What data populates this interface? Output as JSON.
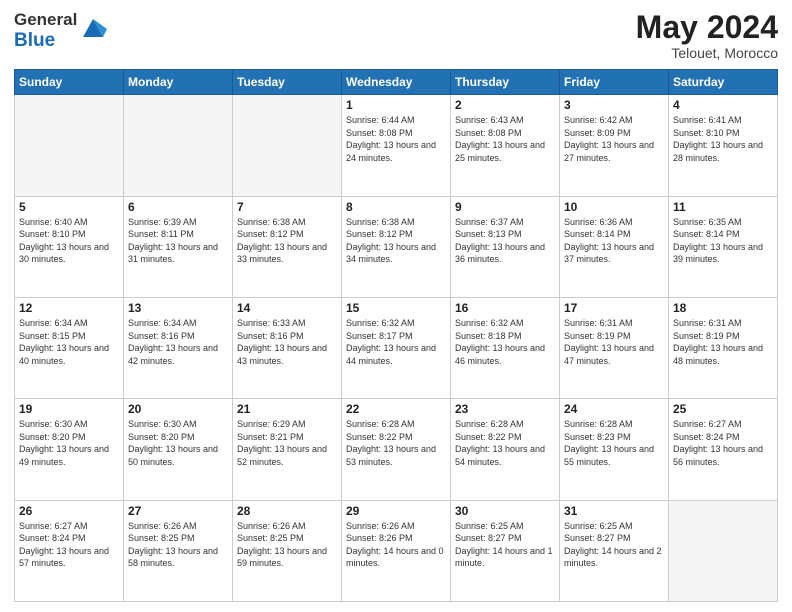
{
  "header": {
    "logo_general": "General",
    "logo_blue": "Blue",
    "title": "May 2024",
    "location": "Telouet, Morocco"
  },
  "weekdays": [
    "Sunday",
    "Monday",
    "Tuesday",
    "Wednesday",
    "Thursday",
    "Friday",
    "Saturday"
  ],
  "weeks": [
    [
      {
        "day": "",
        "sunrise": "",
        "sunset": "",
        "daylight": "",
        "empty": true
      },
      {
        "day": "",
        "sunrise": "",
        "sunset": "",
        "daylight": "",
        "empty": true
      },
      {
        "day": "",
        "sunrise": "",
        "sunset": "",
        "daylight": "",
        "empty": true
      },
      {
        "day": "1",
        "sunrise": "Sunrise: 6:44 AM",
        "sunset": "Sunset: 8:08 PM",
        "daylight": "Daylight: 13 hours and 24 minutes.",
        "empty": false
      },
      {
        "day": "2",
        "sunrise": "Sunrise: 6:43 AM",
        "sunset": "Sunset: 8:08 PM",
        "daylight": "Daylight: 13 hours and 25 minutes.",
        "empty": false
      },
      {
        "day": "3",
        "sunrise": "Sunrise: 6:42 AM",
        "sunset": "Sunset: 8:09 PM",
        "daylight": "Daylight: 13 hours and 27 minutes.",
        "empty": false
      },
      {
        "day": "4",
        "sunrise": "Sunrise: 6:41 AM",
        "sunset": "Sunset: 8:10 PM",
        "daylight": "Daylight: 13 hours and 28 minutes.",
        "empty": false
      }
    ],
    [
      {
        "day": "5",
        "sunrise": "Sunrise: 6:40 AM",
        "sunset": "Sunset: 8:10 PM",
        "daylight": "Daylight: 13 hours and 30 minutes.",
        "empty": false
      },
      {
        "day": "6",
        "sunrise": "Sunrise: 6:39 AM",
        "sunset": "Sunset: 8:11 PM",
        "daylight": "Daylight: 13 hours and 31 minutes.",
        "empty": false
      },
      {
        "day": "7",
        "sunrise": "Sunrise: 6:38 AM",
        "sunset": "Sunset: 8:12 PM",
        "daylight": "Daylight: 13 hours and 33 minutes.",
        "empty": false
      },
      {
        "day": "8",
        "sunrise": "Sunrise: 6:38 AM",
        "sunset": "Sunset: 8:12 PM",
        "daylight": "Daylight: 13 hours and 34 minutes.",
        "empty": false
      },
      {
        "day": "9",
        "sunrise": "Sunrise: 6:37 AM",
        "sunset": "Sunset: 8:13 PM",
        "daylight": "Daylight: 13 hours and 36 minutes.",
        "empty": false
      },
      {
        "day": "10",
        "sunrise": "Sunrise: 6:36 AM",
        "sunset": "Sunset: 8:14 PM",
        "daylight": "Daylight: 13 hours and 37 minutes.",
        "empty": false
      },
      {
        "day": "11",
        "sunrise": "Sunrise: 6:35 AM",
        "sunset": "Sunset: 8:14 PM",
        "daylight": "Daylight: 13 hours and 39 minutes.",
        "empty": false
      }
    ],
    [
      {
        "day": "12",
        "sunrise": "Sunrise: 6:34 AM",
        "sunset": "Sunset: 8:15 PM",
        "daylight": "Daylight: 13 hours and 40 minutes.",
        "empty": false
      },
      {
        "day": "13",
        "sunrise": "Sunrise: 6:34 AM",
        "sunset": "Sunset: 8:16 PM",
        "daylight": "Daylight: 13 hours and 42 minutes.",
        "empty": false
      },
      {
        "day": "14",
        "sunrise": "Sunrise: 6:33 AM",
        "sunset": "Sunset: 8:16 PM",
        "daylight": "Daylight: 13 hours and 43 minutes.",
        "empty": false
      },
      {
        "day": "15",
        "sunrise": "Sunrise: 6:32 AM",
        "sunset": "Sunset: 8:17 PM",
        "daylight": "Daylight: 13 hours and 44 minutes.",
        "empty": false
      },
      {
        "day": "16",
        "sunrise": "Sunrise: 6:32 AM",
        "sunset": "Sunset: 8:18 PM",
        "daylight": "Daylight: 13 hours and 46 minutes.",
        "empty": false
      },
      {
        "day": "17",
        "sunrise": "Sunrise: 6:31 AM",
        "sunset": "Sunset: 8:19 PM",
        "daylight": "Daylight: 13 hours and 47 minutes.",
        "empty": false
      },
      {
        "day": "18",
        "sunrise": "Sunrise: 6:31 AM",
        "sunset": "Sunset: 8:19 PM",
        "daylight": "Daylight: 13 hours and 48 minutes.",
        "empty": false
      }
    ],
    [
      {
        "day": "19",
        "sunrise": "Sunrise: 6:30 AM",
        "sunset": "Sunset: 8:20 PM",
        "daylight": "Daylight: 13 hours and 49 minutes.",
        "empty": false
      },
      {
        "day": "20",
        "sunrise": "Sunrise: 6:30 AM",
        "sunset": "Sunset: 8:20 PM",
        "daylight": "Daylight: 13 hours and 50 minutes.",
        "empty": false
      },
      {
        "day": "21",
        "sunrise": "Sunrise: 6:29 AM",
        "sunset": "Sunset: 8:21 PM",
        "daylight": "Daylight: 13 hours and 52 minutes.",
        "empty": false
      },
      {
        "day": "22",
        "sunrise": "Sunrise: 6:28 AM",
        "sunset": "Sunset: 8:22 PM",
        "daylight": "Daylight: 13 hours and 53 minutes.",
        "empty": false
      },
      {
        "day": "23",
        "sunrise": "Sunrise: 6:28 AM",
        "sunset": "Sunset: 8:22 PM",
        "daylight": "Daylight: 13 hours and 54 minutes.",
        "empty": false
      },
      {
        "day": "24",
        "sunrise": "Sunrise: 6:28 AM",
        "sunset": "Sunset: 8:23 PM",
        "daylight": "Daylight: 13 hours and 55 minutes.",
        "empty": false
      },
      {
        "day": "25",
        "sunrise": "Sunrise: 6:27 AM",
        "sunset": "Sunset: 8:24 PM",
        "daylight": "Daylight: 13 hours and 56 minutes.",
        "empty": false
      }
    ],
    [
      {
        "day": "26",
        "sunrise": "Sunrise: 6:27 AM",
        "sunset": "Sunset: 8:24 PM",
        "daylight": "Daylight: 13 hours and 57 minutes.",
        "empty": false
      },
      {
        "day": "27",
        "sunrise": "Sunrise: 6:26 AM",
        "sunset": "Sunset: 8:25 PM",
        "daylight": "Daylight: 13 hours and 58 minutes.",
        "empty": false
      },
      {
        "day": "28",
        "sunrise": "Sunrise: 6:26 AM",
        "sunset": "Sunset: 8:25 PM",
        "daylight": "Daylight: 13 hours and 59 minutes.",
        "empty": false
      },
      {
        "day": "29",
        "sunrise": "Sunrise: 6:26 AM",
        "sunset": "Sunset: 8:26 PM",
        "daylight": "Daylight: 14 hours and 0 minutes.",
        "empty": false
      },
      {
        "day": "30",
        "sunrise": "Sunrise: 6:25 AM",
        "sunset": "Sunset: 8:27 PM",
        "daylight": "Daylight: 14 hours and 1 minute.",
        "empty": false
      },
      {
        "day": "31",
        "sunrise": "Sunrise: 6:25 AM",
        "sunset": "Sunset: 8:27 PM",
        "daylight": "Daylight: 14 hours and 2 minutes.",
        "empty": false
      },
      {
        "day": "",
        "sunrise": "",
        "sunset": "",
        "daylight": "",
        "empty": true
      }
    ]
  ]
}
